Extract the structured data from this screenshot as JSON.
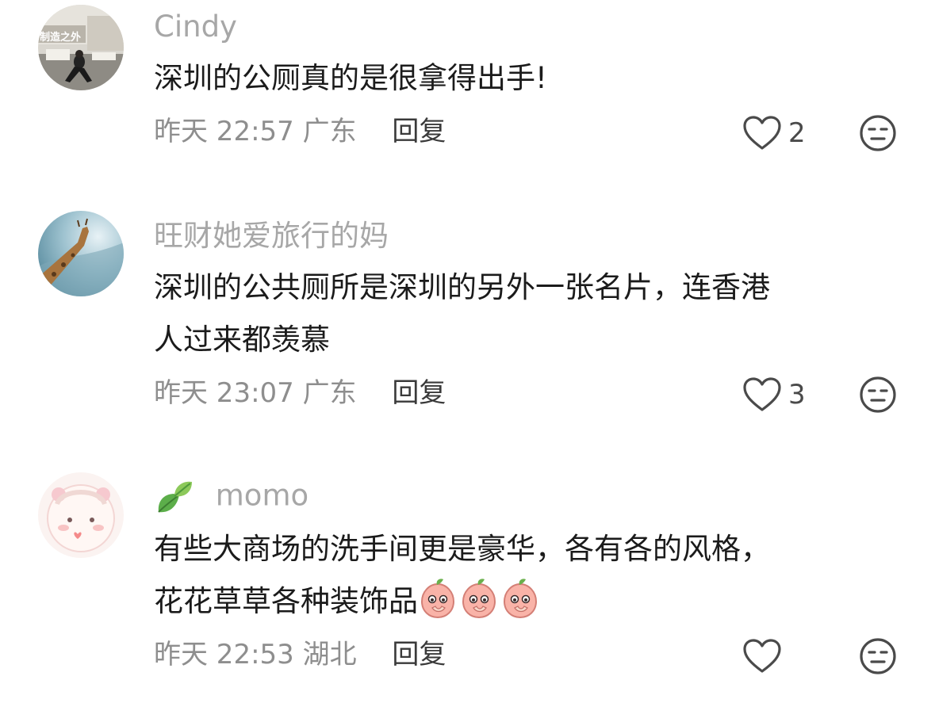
{
  "comments": [
    {
      "avatar": "user-photo-avatar",
      "avatar_overlay_text": "制造之外",
      "username": "Cindy",
      "text_lines": [
        "深圳的公厕真的是很拿得出手!"
      ],
      "time": "昨天 22:57",
      "location": "广东",
      "reply_label": "回复",
      "like_count": "2"
    },
    {
      "avatar": "giraffe-avatar",
      "username": "旺财她爱旅行的妈",
      "text_lines": [
        "深圳的公共厕所是深圳的另外一张名片，连香港",
        "人过来都羡慕"
      ],
      "time": "昨天 23:07",
      "location": "广东",
      "reply_label": "回复",
      "like_count": "3"
    },
    {
      "avatar": "cartoon-girl-avatar",
      "badge": "leaf-icon",
      "username": "momo",
      "text_lines": [
        "有些大商场的洗手间更是豪华，各有各的风格，",
        "花花草草各种装饰品"
      ],
      "emojis": [
        "peach-emoji",
        "peach-emoji",
        "peach-emoji"
      ],
      "time": "昨天 22:53",
      "location": "湖北",
      "reply_label": "回复",
      "like_count": ""
    }
  ],
  "colors": {
    "username": "#a7a7a7",
    "body": "#1b1b1b",
    "meta": "#8e8e8e",
    "reply": "#3a3a3a",
    "icon": "#4a4a4a"
  }
}
